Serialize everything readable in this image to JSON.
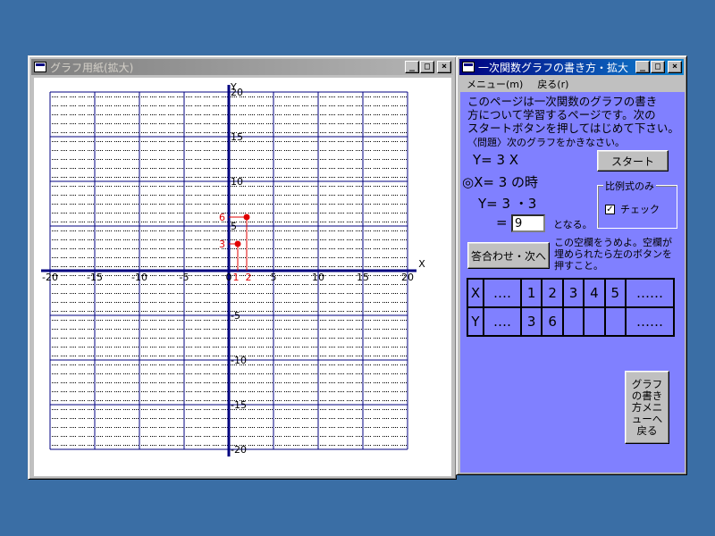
{
  "graph_window": {
    "title": "グラフ用紙(拡大)",
    "axis_x_label": "X",
    "axis_y_label": "Y",
    "x_ticks": [
      "-20",
      "-15",
      "-10",
      "-5",
      "0",
      "5",
      "10",
      "15",
      "20"
    ],
    "y_ticks": [
      "20",
      "15",
      "10",
      "5",
      "-5",
      "-10",
      "-15",
      "-20"
    ],
    "point_labels": {
      "x1": "1",
      "x2": "2",
      "y1": "3",
      "y2": "6"
    },
    "points": [
      {
        "x": 1,
        "y": 3
      },
      {
        "x": 2,
        "y": 6
      }
    ],
    "range": [
      -20,
      20
    ],
    "colors": {
      "grid": "#000080",
      "axis": "#000080",
      "point": "#e00000"
    }
  },
  "main_window": {
    "title": "一次関数グラフの書き方・拡大",
    "menu": [
      "メニュー(m)",
      "戻る(r)"
    ],
    "intro_text_lines": [
      "このページは一次関数のグラフの書き",
      "方について学習するページです。次の",
      "スタートボタンを押してはじめて下さい。"
    ],
    "problem_text": "〈問題〉次のグラフをかきなさい。",
    "equation": "Y=  3  X",
    "when_text": "◎X= 3  の時",
    "calc_text": "Y=   3 ・3",
    "equals": "=",
    "answer_value": "9",
    "becomes": "となる。",
    "start_button": "スタート",
    "proportional_group": "比例式のみ",
    "check_label": "チェック",
    "check_checked": true,
    "answer_button": "答合わせ・次へ",
    "hint_lines": [
      "この空欄をうめよ。空欄が",
      "埋められたら左のボタンを",
      "押すこと。"
    ],
    "table": {
      "row_x": [
        "X",
        "‥‥",
        "1",
        "2",
        "3",
        "4",
        "5",
        "‥‥‥"
      ],
      "row_y": [
        "Y",
        "‥‥",
        "3",
        "6",
        "",
        "",
        "",
        "‥‥‥"
      ]
    },
    "back_button_lines": [
      "グラフ",
      "の書き",
      "方メニ",
      "ューへ",
      "戻る"
    ],
    "colors": {
      "panel": "#8080ff"
    }
  }
}
